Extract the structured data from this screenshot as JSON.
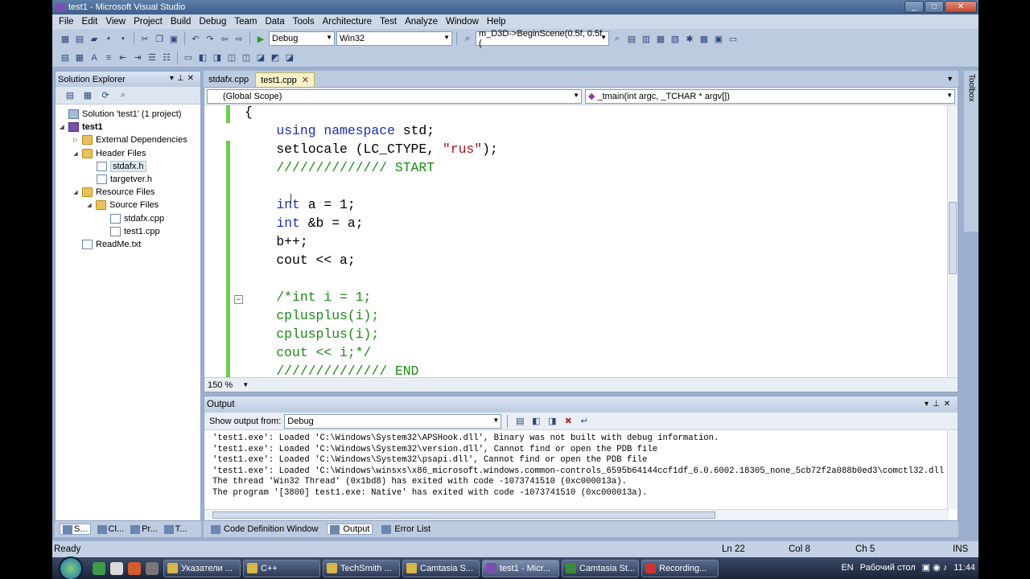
{
  "window": {
    "title": "test1 - Microsoft Visual Studio"
  },
  "menu": [
    "File",
    "Edit",
    "View",
    "Project",
    "Build",
    "Debug",
    "Team",
    "Data",
    "Tools",
    "Architecture",
    "Test",
    "Analyze",
    "Window",
    "Help"
  ],
  "toolbar": {
    "config": "Debug",
    "platform": "Win32",
    "find": "m_D3D->BeginScene(0.5f, 0.5f, ("
  },
  "solution_explorer": {
    "title": "Solution Explorer",
    "items": [
      {
        "label": "Solution 'test1' (1 project)",
        "icon": "solution-icon"
      },
      {
        "label": "test1",
        "icon": "project-icon"
      },
      {
        "label": "External Dependencies",
        "icon": "folder-icon"
      },
      {
        "label": "Header Files",
        "icon": "folder-icon"
      },
      {
        "label": "stdafx.h",
        "icon": "header-file-icon"
      },
      {
        "label": "targetver.h",
        "icon": "header-file-icon"
      },
      {
        "label": "Resource Files",
        "icon": "folder-icon"
      },
      {
        "label": "Source Files",
        "icon": "folder-icon"
      },
      {
        "label": "stdafx.cpp",
        "icon": "cpp-file-icon"
      },
      {
        "label": "test1.cpp",
        "icon": "cpp-file-icon"
      },
      {
        "label": "ReadMe.txt",
        "icon": "text-file-icon"
      }
    ],
    "tabs": [
      "S...",
      "Cl...",
      "Pr...",
      "T..."
    ]
  },
  "editor": {
    "tabs": [
      "stdafx.cpp",
      "test1.cpp"
    ],
    "scope": "(Global Scope)",
    "member": "_tmain(int argc, _TCHAR * argv[])",
    "zoom": "150 %",
    "lines": [
      [
        {
          "t": "{",
          "c": ""
        }
      ],
      [
        {
          "t": "    ",
          "c": ""
        },
        {
          "t": "using namespace",
          "c": "kw"
        },
        {
          "t": " std;",
          "c": ""
        }
      ],
      [
        {
          "t": "    setlocale (LC_CTYPE, ",
          "c": ""
        },
        {
          "t": "\"rus\"",
          "c": "str"
        },
        {
          "t": ");",
          "c": ""
        }
      ],
      [
        {
          "t": "    ////////////// START",
          "c": "cmt"
        }
      ],
      [
        {
          "t": "",
          "c": ""
        }
      ],
      [
        {
          "t": "    ",
          "c": ""
        },
        {
          "t": "int",
          "c": "kw"
        },
        {
          "t": " a = 1;",
          "c": ""
        }
      ],
      [
        {
          "t": "    ",
          "c": ""
        },
        {
          "t": "int",
          "c": "kw"
        },
        {
          "t": " &b = a;",
          "c": ""
        }
      ],
      [
        {
          "t": "    b++;",
          "c": ""
        }
      ],
      [
        {
          "t": "    cout << a;",
          "c": ""
        }
      ],
      [
        {
          "t": "",
          "c": ""
        }
      ],
      [
        {
          "t": "    /*int i = 1;",
          "c": "cmt"
        }
      ],
      [
        {
          "t": "    cplusplus(i);",
          "c": "cmt"
        }
      ],
      [
        {
          "t": "    cplusplus(i);",
          "c": "cmt"
        }
      ],
      [
        {
          "t": "    cout << i;*/",
          "c": "cmt"
        }
      ],
      [
        {
          "t": "    ////////////// END",
          "c": "cmt"
        }
      ]
    ]
  },
  "output": {
    "title": "Output",
    "show_from_label": "Show output from:",
    "show_from_value": "Debug",
    "lines": [
      "'test1.exe': Loaded 'C:\\Windows\\System32\\APSHook.dll', Binary was not built with debug information.",
      "'test1.exe': Loaded 'C:\\Windows\\System32\\version.dll', Cannot find or open the PDB file",
      "'test1.exe': Loaded 'C:\\Windows\\System32\\psapi.dll', Cannot find or open the PDB file",
      "'test1.exe': Loaded 'C:\\Windows\\winsxs\\x86_microsoft.windows.common-controls_6595b64144ccf1df_6.0.6002.18305_none_5cb72f2a088b0ed3\\comctl32.dll',",
      "The thread 'Win32 Thread' (0x1bd8) has exited with code -1073741510 (0xc000013a).",
      "The program '[3800] test1.exe: Native' has exited with code -1073741510 (0xc000013a)."
    ],
    "tabs": [
      "Code Definition Window",
      "Output",
      "Error List"
    ]
  },
  "toolbox_label": "Toolbox",
  "status": {
    "ready": "Ready",
    "ln": "Ln 22",
    "col": "Col 8",
    "ch": "Ch 5",
    "ins": "INS"
  },
  "taskbar": {
    "buttons": [
      "Указатели ...",
      "C++",
      "TechSmith ...",
      "Camtasia S...",
      "test1 - Micr...",
      "Camtasia St...",
      "Recording..."
    ],
    "lang": "EN",
    "desktop": "Рабочий стол",
    "time": "11:44"
  }
}
